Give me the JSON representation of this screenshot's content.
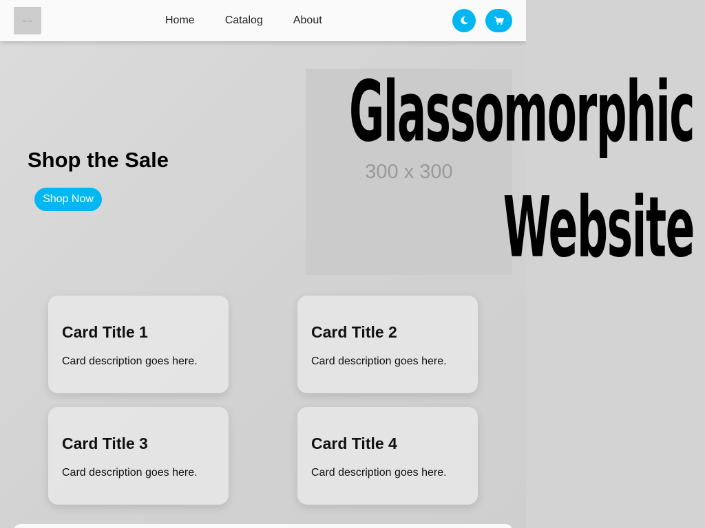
{
  "header": {
    "logo_text": "60 x 60",
    "nav": [
      {
        "label": "Home"
      },
      {
        "label": "Catalog"
      },
      {
        "label": "About"
      }
    ],
    "theme_icon": "moon-icon",
    "cart_icon": "cart-icon",
    "accent_color": "#00b7f1"
  },
  "hero": {
    "title": "Shop the Sale",
    "cta_label": "Shop Now",
    "image_placeholder": "300 x 300"
  },
  "cards": [
    {
      "title": "Card Title 1",
      "description": "Card description goes here."
    },
    {
      "title": "Card Title 2",
      "description": "Card description goes here."
    },
    {
      "title": "Card Title 3",
      "description": "Card description goes here."
    },
    {
      "title": "Card Title 4",
      "description": "Card description goes here."
    }
  ],
  "overlay": {
    "line1": "Glassomorphic",
    "line2": "Website"
  }
}
